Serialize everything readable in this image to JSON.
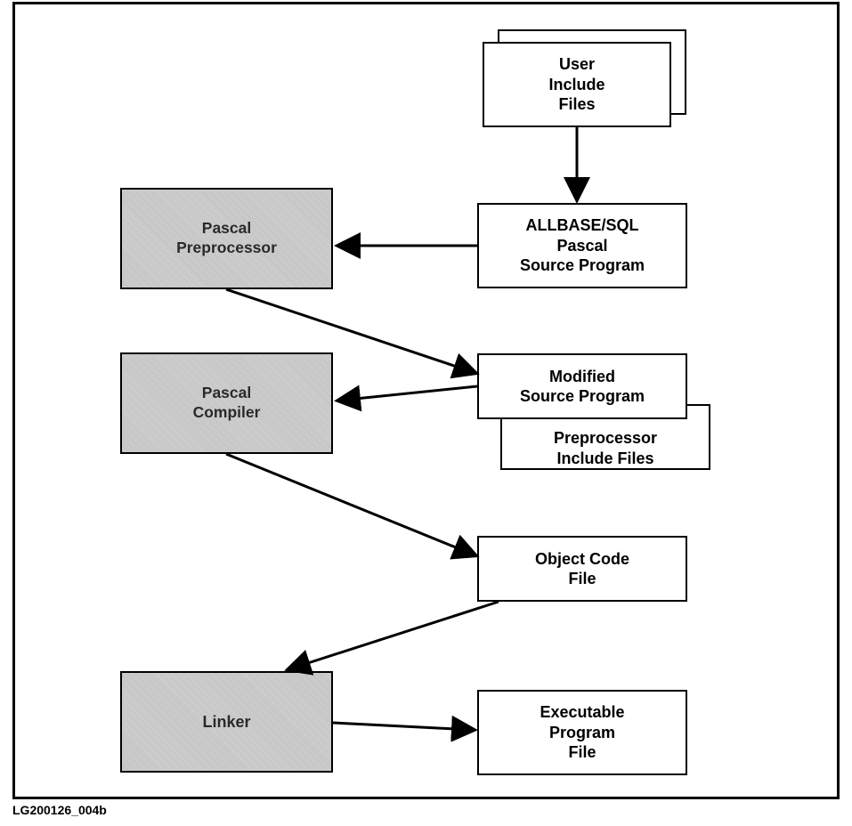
{
  "caption": "LG200126_004b",
  "boxes": {
    "user_include_files": {
      "lines": [
        "User",
        "Include",
        "Files"
      ]
    },
    "allbase_src": {
      "lines": [
        "ALLBASE/SQL",
        "Pascal",
        "Source Program"
      ]
    },
    "preprocessor": {
      "lines": [
        "Pascal",
        "Preprocessor"
      ]
    },
    "modified_src": {
      "lines": [
        "Modified",
        "Source Program"
      ]
    },
    "preproc_inc": {
      "lines": [
        "Preprocessor",
        "Include Files"
      ]
    },
    "compiler": {
      "lines": [
        "Pascal",
        "Compiler"
      ]
    },
    "object_code": {
      "lines": [
        "Object Code",
        "File"
      ]
    },
    "linker": {
      "lines": [
        "Linker"
      ]
    },
    "executable": {
      "lines": [
        "Executable",
        "Program",
        "File"
      ]
    }
  }
}
